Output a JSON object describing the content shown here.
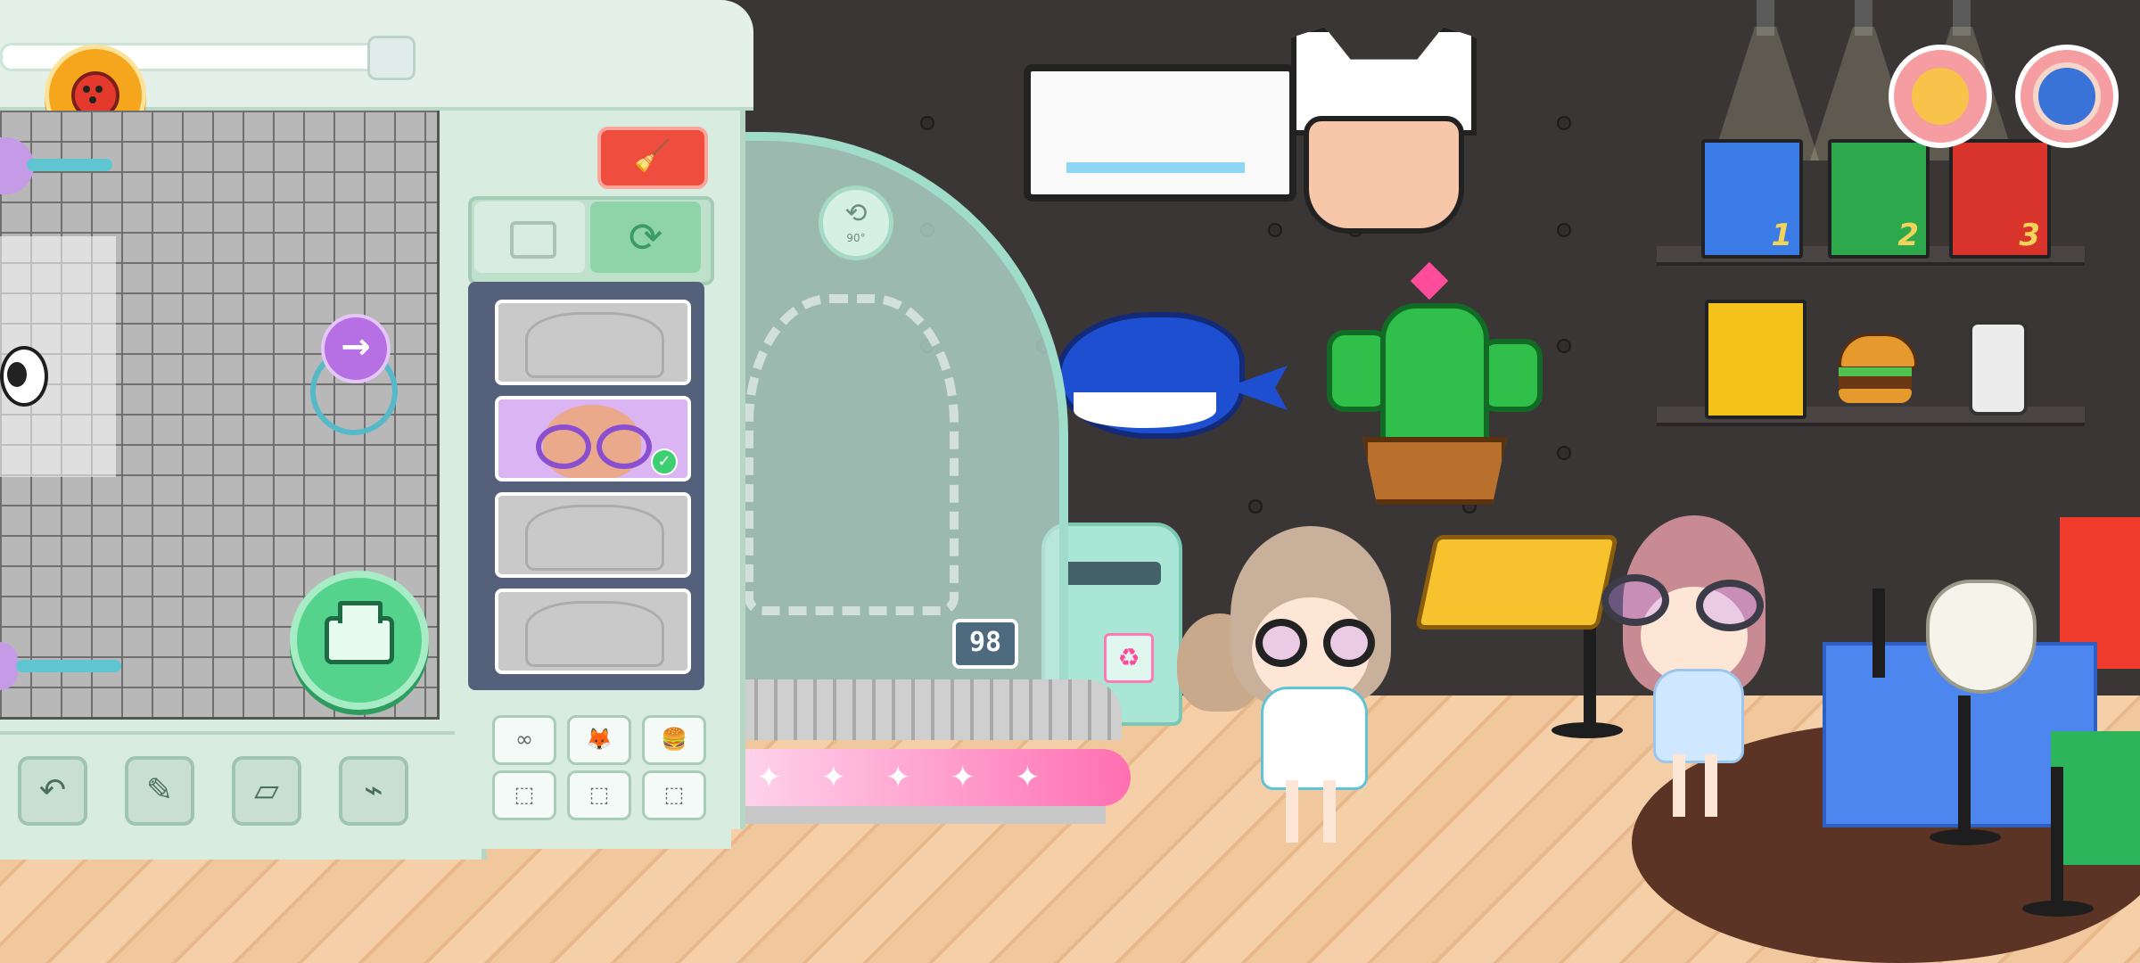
{
  "screen": {
    "title": ""
  },
  "editor": {
    "counter_value": "98",
    "rotate_badge_label": "90°",
    "clean_button_icon": "broom-icon",
    "tabs": [
      {
        "name": "add-template-tab",
        "icon": "add-sticker-icon",
        "selected": false
      },
      {
        "name": "refresh-tab",
        "icon": "recycle-icon",
        "selected": true
      }
    ],
    "items": [
      {
        "name": "strawberry-outfit",
        "selected": false
      },
      {
        "name": "purple-glasses",
        "selected": true
      },
      {
        "name": "magnifier-outfit",
        "selected": false
      },
      {
        "name": "bow-outfit",
        "selected": false
      }
    ],
    "mini_buttons_row1": [
      {
        "name": "glasses-category",
        "glyph": "∞"
      },
      {
        "name": "mask-category",
        "glyph": "🦊"
      },
      {
        "name": "burger-category",
        "glyph": "🍔"
      }
    ],
    "mini_buttons_row2": [
      {
        "name": "empty-slot-1",
        "glyph": "⬚"
      },
      {
        "name": "empty-slot-2",
        "glyph": "⬚"
      },
      {
        "name": "empty-slot-3",
        "glyph": "⬚"
      }
    ],
    "tools": [
      {
        "name": "undo-button",
        "glyph": "↶"
      },
      {
        "name": "sticker-tool-button",
        "glyph": "✎"
      },
      {
        "name": "eraser-button",
        "glyph": "▱"
      },
      {
        "name": "eyedropper-button",
        "glyph": "⌁"
      }
    ],
    "rotate_arrow": "→"
  },
  "colors": {
    "accent_green": "#55d38c",
    "accent_purple": "#b76fe4",
    "clean_red": "#ef4d3d",
    "panel_green": "#d8ece0",
    "counter_bg": "#4e6a7e",
    "belt_pink": "#ff6fb2"
  },
  "books": [
    {
      "name": "book-1",
      "numeral": "1",
      "color": "#3b7be6"
    },
    {
      "name": "book-2",
      "numeral": "2",
      "color": "#2ea84d"
    },
    {
      "name": "book-3",
      "numeral": "3",
      "color": "#d9342b"
    },
    {
      "name": "book-4",
      "numeral": "",
      "color": "#f3c31c"
    }
  ]
}
